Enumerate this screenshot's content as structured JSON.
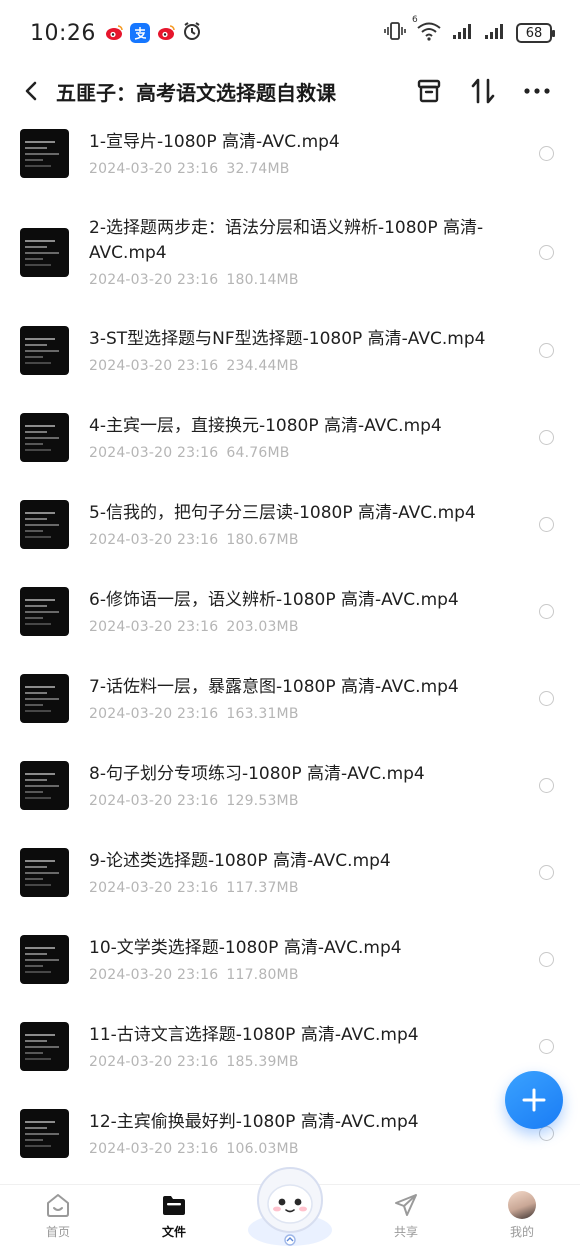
{
  "status_bar": {
    "time": "10:26",
    "signal_label": "6",
    "battery": "68"
  },
  "header": {
    "title": "五匪子：高考语文选择题自救课"
  },
  "files": [
    {
      "name": "1-宣导片-1080P 高清-AVC.mp4",
      "date": "2024-03-20  23:16",
      "size": "32.74MB"
    },
    {
      "name": "2-选择题两步走：语法分层和语义辨析-1080P 高清-AVC.mp4",
      "date": "2024-03-20  23:16",
      "size": "180.14MB"
    },
    {
      "name": "3-ST型选择题与NF型选择题-1080P 高清-AVC.mp4",
      "date": "2024-03-20  23:16",
      "size": "234.44MB"
    },
    {
      "name": "4-主宾一层，直接换元-1080P 高清-AVC.mp4",
      "date": "2024-03-20  23:16",
      "size": "64.76MB"
    },
    {
      "name": "5-信我的，把句子分三层读-1080P 高清-AVC.mp4",
      "date": "2024-03-20  23:16",
      "size": "180.67MB"
    },
    {
      "name": "6-修饰语一层，语义辨析-1080P 高清-AVC.mp4",
      "date": "2024-03-20  23:16",
      "size": "203.03MB"
    },
    {
      "name": "7-话佐料一层，暴露意图-1080P 高清-AVC.mp4",
      "date": "2024-03-20  23:16",
      "size": "163.31MB"
    },
    {
      "name": "8-句子划分专项练习-1080P 高清-AVC.mp4",
      "date": "2024-03-20  23:16",
      "size": "129.53MB"
    },
    {
      "name": "9-论述类选择题-1080P 高清-AVC.mp4",
      "date": "2024-03-20  23:16",
      "size": "117.37MB"
    },
    {
      "name": "10-文学类选择题-1080P 高清-AVC.mp4",
      "date": "2024-03-20  23:16",
      "size": "117.80MB"
    },
    {
      "name": "11-古诗文言选择题-1080P 高清-AVC.mp4",
      "date": "2024-03-20  23:16",
      "size": "185.39MB"
    },
    {
      "name": "12-主宾偷换最好判-1080P 高清-AVC.mp4",
      "date": "2024-03-20  23:16",
      "size": "106.03MB"
    }
  ],
  "bottom_nav": {
    "home": "首页",
    "files": "文件",
    "share": "共享",
    "mine": "我的"
  },
  "colors": {
    "accent": "#1a7cf5",
    "meta_text": "#b5b5b5"
  }
}
